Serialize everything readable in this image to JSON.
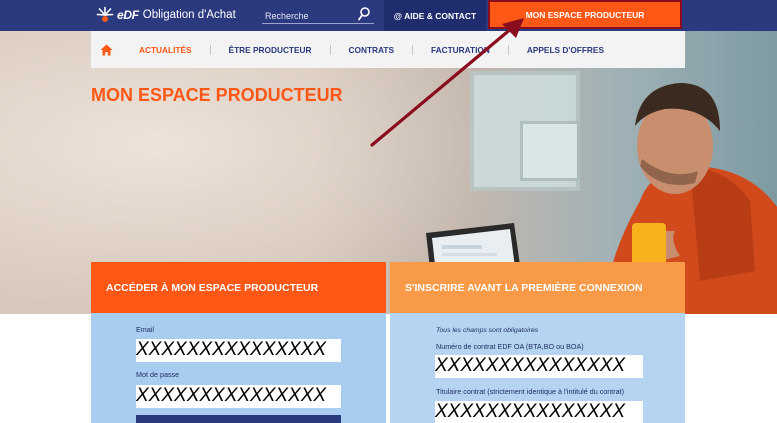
{
  "header": {
    "logo_brand": "eDF",
    "logo_text": "Obligation d'Achat",
    "search_placeholder": "Recherche",
    "aide_label": "@ AIDE & CONTACT",
    "espace_label": "MON ESPACE PRODUCTEUR"
  },
  "nav": {
    "items": [
      {
        "label": "ACTUALITÉS",
        "active": true
      },
      {
        "label": "ÊTRE PRODUCTEUR"
      },
      {
        "label": "CONTRATS"
      },
      {
        "label": "FACTURATION"
      },
      {
        "label": "APPELS D'OFFRES"
      }
    ]
  },
  "page_title": "MON ESPACE PRODUCTEUR",
  "login_panel": {
    "title": "ACCÉDER À MON ESPACE PRODUCTEUR",
    "email_label": "Email",
    "email_value": "XXXXXXXXXXXXXXX",
    "password_label": "Mot de passe",
    "password_value": "XXXXXXXXXXXXXXX"
  },
  "register_panel": {
    "title": "S'INSCRIRE AVANT LA PREMIÈRE CONNEXION",
    "required_note": "Tous les champs sont obligatoires",
    "contract_label": "Numéro de contrat EDF OA (BTA,BO ou BOA)",
    "contract_value": "XXXXXXXXXXXXXXX",
    "holder_label": "Titulaire contrat (strictement identique à l'intitulé du contrat)",
    "holder_value": "XXXXXXXXXXXXXXX"
  },
  "colors": {
    "topbar": "#2b3a7e",
    "accent": "#fe5716",
    "highlight_border": "#8a0d1e",
    "arrow": "#8a0d1e"
  },
  "icons": [
    "edf-logo-icon",
    "search-icon",
    "home-icon"
  ]
}
